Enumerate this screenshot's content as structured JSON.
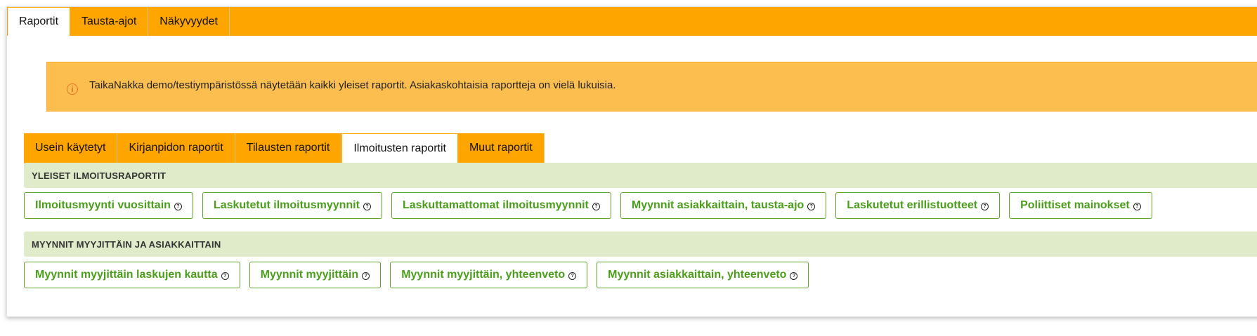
{
  "top_tabs": [
    {
      "label": "Raportit"
    },
    {
      "label": "Tausta-ajot"
    },
    {
      "label": "Näkyvyydet"
    }
  ],
  "notice": {
    "icon": "info-icon",
    "text": "TaikaNakka demo/testiympäristössä näytetään kaikki yleiset raportit. Asiakaskohtaisia raportteja on vielä lukuisia."
  },
  "sub_tabs": [
    {
      "label": "Usein käytetyt"
    },
    {
      "label": "Kirjanpidon raportit"
    },
    {
      "label": "Tilausten raportit"
    },
    {
      "label": "Ilmoitusten raportit"
    },
    {
      "label": "Muut raportit"
    }
  ],
  "active_sub_tab": "Ilmoitusten raportit",
  "sections": [
    {
      "title": "YLEISET ILMOITUSRAPORTIT",
      "reports": [
        {
          "label": "Ilmoitusmyynti vuosittain"
        },
        {
          "label": "Laskutetut ilmoitusmyynnit"
        },
        {
          "label": "Laskuttamattomat ilmoitusmyynnit"
        },
        {
          "label": "Myynnit asiakkaittain, tausta-ajo"
        },
        {
          "label": "Laskutetut erillistuotteet"
        },
        {
          "label": "Poliittiset mainokset"
        }
      ]
    },
    {
      "title": "MYYNNIT MYYJITTÄIN JA ASIAKKAITTAIN",
      "reports": [
        {
          "label": "Myynnit myyjittäin laskujen kautta"
        },
        {
          "label": "Myynnit myyjittäin"
        },
        {
          "label": "Myynnit myyjittäin, yhteenveto"
        },
        {
          "label": "Myynnit asiakkaittain, yhteenveto"
        }
      ]
    }
  ],
  "help_glyph": "?",
  "colors": {
    "accent_orange": "#ffa500",
    "notice_bg": "#fcbf4f",
    "section_bg": "#e0ebc9",
    "report_green": "#4a9e1a"
  }
}
